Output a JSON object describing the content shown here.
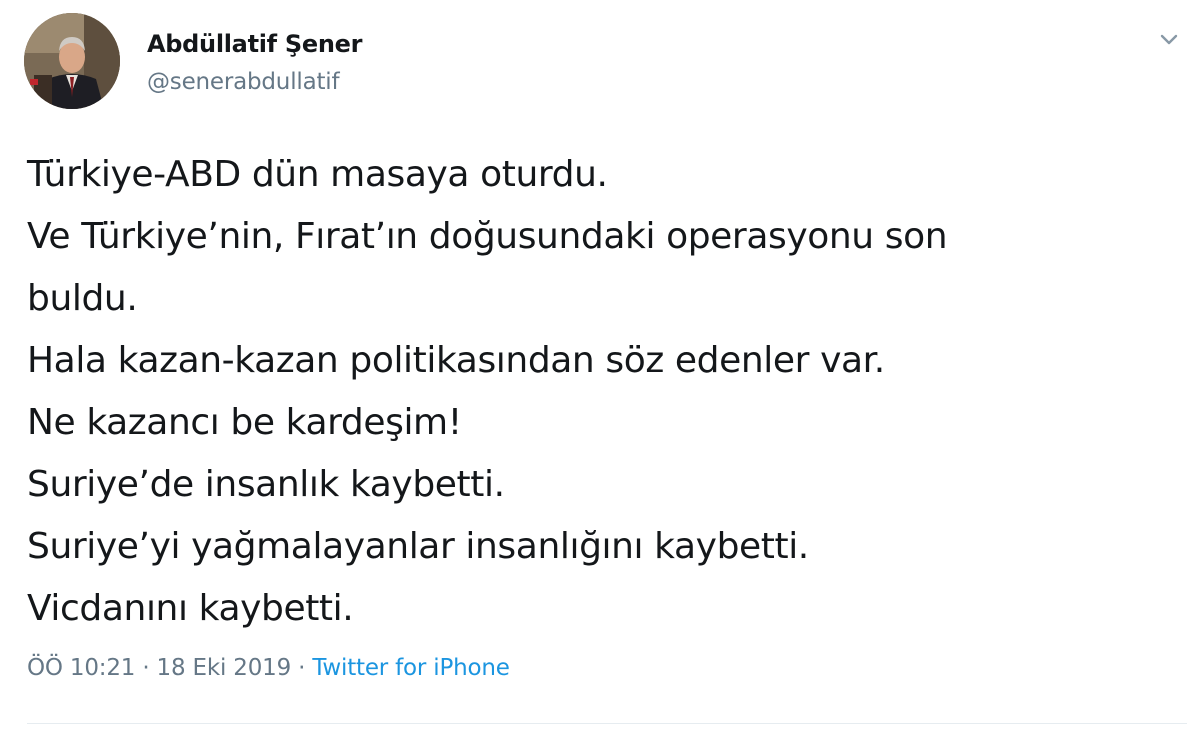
{
  "author": {
    "name": "Abdüllatif Şener",
    "handle": "@senerabdullatif"
  },
  "tweet": {
    "lines": [
      "Türkiye-ABD dün masaya oturdu.",
      "Ve Türkiye’nin, Fırat’ın doğusundaki operasyonu son",
      "buldu.",
      "Hala kazan-kazan politikasından söz edenler var.",
      "Ne kazancı be kardeşim!",
      "Suriye’de insanlık kaybetti.",
      "Suriye’yi yağmalayanlar insanlığını kaybetti.",
      "Vicdanını kaybetti."
    ]
  },
  "meta": {
    "time": "ÖÖ 10:21",
    "separator1": " · ",
    "date": "18 Eki 2019",
    "separator2": " · ",
    "source": "Twitter for iPhone"
  },
  "icons": {
    "menu": "chevron-down-icon"
  },
  "colors": {
    "text": "#14171a",
    "secondary": "#657786",
    "link": "#1b95e0",
    "divider": "#e6ecf0"
  }
}
